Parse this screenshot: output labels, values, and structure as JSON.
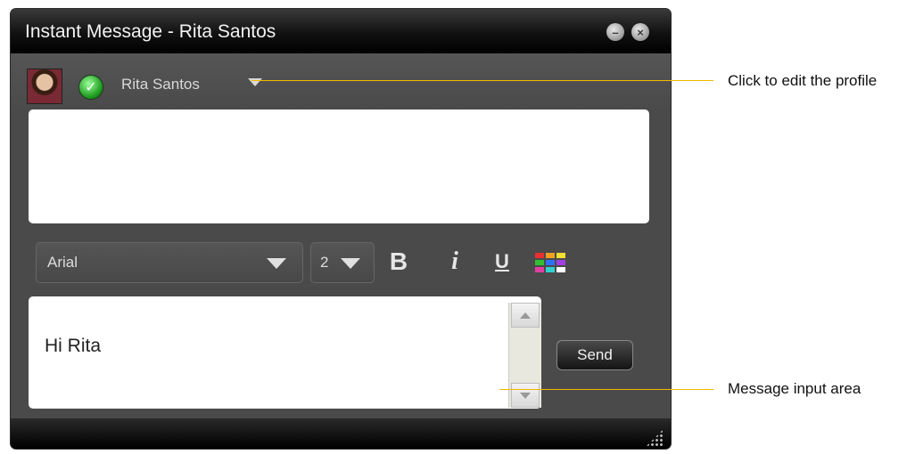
{
  "window": {
    "title": "Instant Message - Rita Santos",
    "minimize_icon": "minimize-icon",
    "close_icon": "close-icon"
  },
  "contact": {
    "name": "Rita Santos",
    "avatar_icon": "contact-photo",
    "status_icon": "available-checkmark-icon",
    "dropdown_icon": "triangle-down-icon"
  },
  "toolbar": {
    "font_value": "Arial",
    "size_value": "2",
    "bold_label": "B",
    "italic_label": "i",
    "underline_label": "U",
    "color_icon": "color-palette-icon",
    "color_swatches": [
      "#e83030",
      "#f0a020",
      "#f0e030",
      "#30c030",
      "#3070ff",
      "#a040e0",
      "#e040a0",
      "#30d0d0",
      "#ffffff"
    ]
  },
  "composer": {
    "message_value": "Hi Rita",
    "send_label": "Send"
  },
  "callouts": {
    "profile_label": "Click to edit the profile",
    "input_label": "Message input area"
  },
  "colors": {
    "window_background": "#4a4a4a",
    "titlebar": "#000000",
    "callout_line": "#f2b800"
  }
}
